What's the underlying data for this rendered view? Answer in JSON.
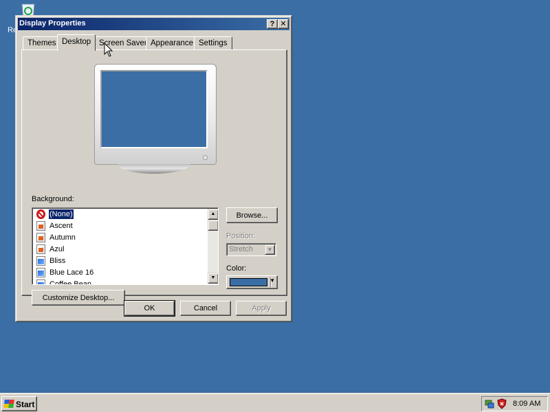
{
  "desktop": {
    "icon_label": "Re",
    "background_color": "#3a6ea5"
  },
  "window": {
    "title": "Display Properties",
    "help_button": "?",
    "close_button": "✕",
    "tabs": [
      "Themes",
      "Desktop",
      "Screen Saver",
      "Appearance",
      "Settings"
    ],
    "active_tab": "Desktop"
  },
  "desktop_tab": {
    "background_label": "Background:",
    "background_items": [
      {
        "name": "(None)",
        "icon": "none-icon",
        "selected": true
      },
      {
        "name": "Ascent",
        "icon": "html-file-icon"
      },
      {
        "name": "Autumn",
        "icon": "html-file-icon"
      },
      {
        "name": "Azul",
        "icon": "html-file-icon"
      },
      {
        "name": "Bliss",
        "icon": "bitmap-file-icon"
      },
      {
        "name": "Blue Lace 16",
        "icon": "bitmap-file-icon"
      },
      {
        "name": "Coffee Bean",
        "icon": "bitmap-file-icon"
      }
    ],
    "browse_button": "Browse...",
    "position_label": "Position:",
    "position_value": "Stretch",
    "color_label": "Color:",
    "color_value": "#3a6ea5",
    "customize_button": "Customize Desktop..."
  },
  "dialog_buttons": {
    "ok": "OK",
    "cancel": "Cancel",
    "apply": "Apply"
  },
  "taskbar": {
    "start_label": "Start",
    "clock": "8:09 AM",
    "tray_icons": [
      "network-icon",
      "security-shield-icon"
    ]
  }
}
